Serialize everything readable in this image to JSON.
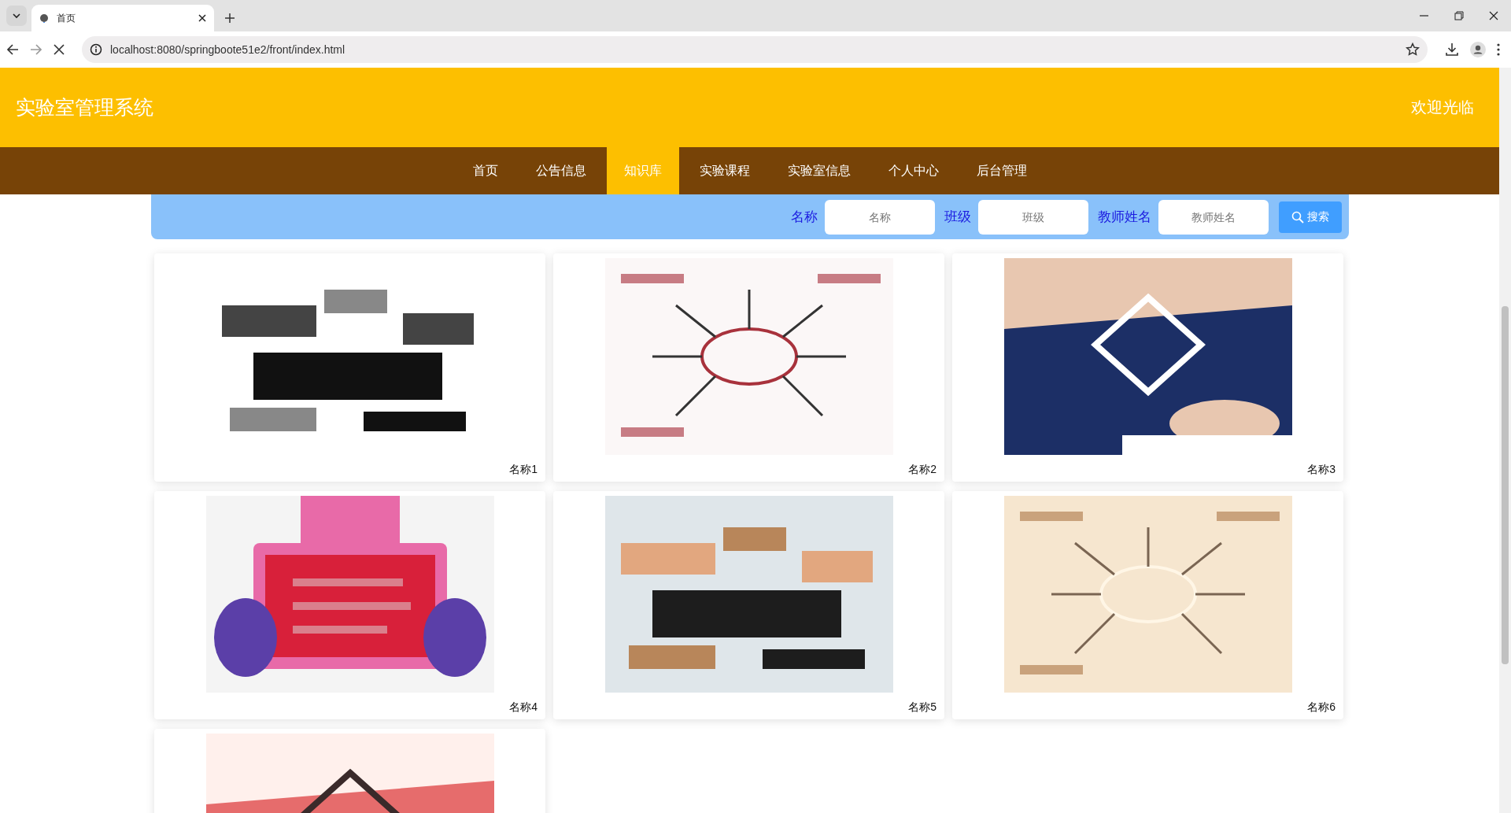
{
  "browser": {
    "tab_title": "首页",
    "url": "localhost:8080/springboote51e2/front/index.html"
  },
  "header": {
    "title": "实验室管理系统",
    "welcome": "欢迎光临"
  },
  "nav": [
    {
      "label": "首页",
      "selected": false
    },
    {
      "label": "公告信息",
      "selected": false
    },
    {
      "label": "知识库",
      "selected": true
    },
    {
      "label": "实验课程",
      "selected": false
    },
    {
      "label": "实验室信息",
      "selected": false
    },
    {
      "label": "个人中心",
      "selected": false
    },
    {
      "label": "后台管理",
      "selected": false
    }
  ],
  "search": {
    "fields": [
      {
        "label": "名称",
        "placeholder": "名称"
      },
      {
        "label": "班级",
        "placeholder": "班级"
      },
      {
        "label": "教师姓名",
        "placeholder": "教师姓名"
      }
    ],
    "button": "搜索"
  },
  "cards": [
    {
      "kind": "picture",
      "name": "名称1"
    },
    {
      "kind": "picture",
      "name": "名称2"
    },
    {
      "kind": "picture",
      "name": "名称3"
    },
    {
      "kind": "picture",
      "name": "名称4"
    },
    {
      "kind": "picture",
      "name": "名称5"
    },
    {
      "kind": "picture",
      "name": "名称6"
    },
    {
      "kind": "picture"
    }
  ]
}
